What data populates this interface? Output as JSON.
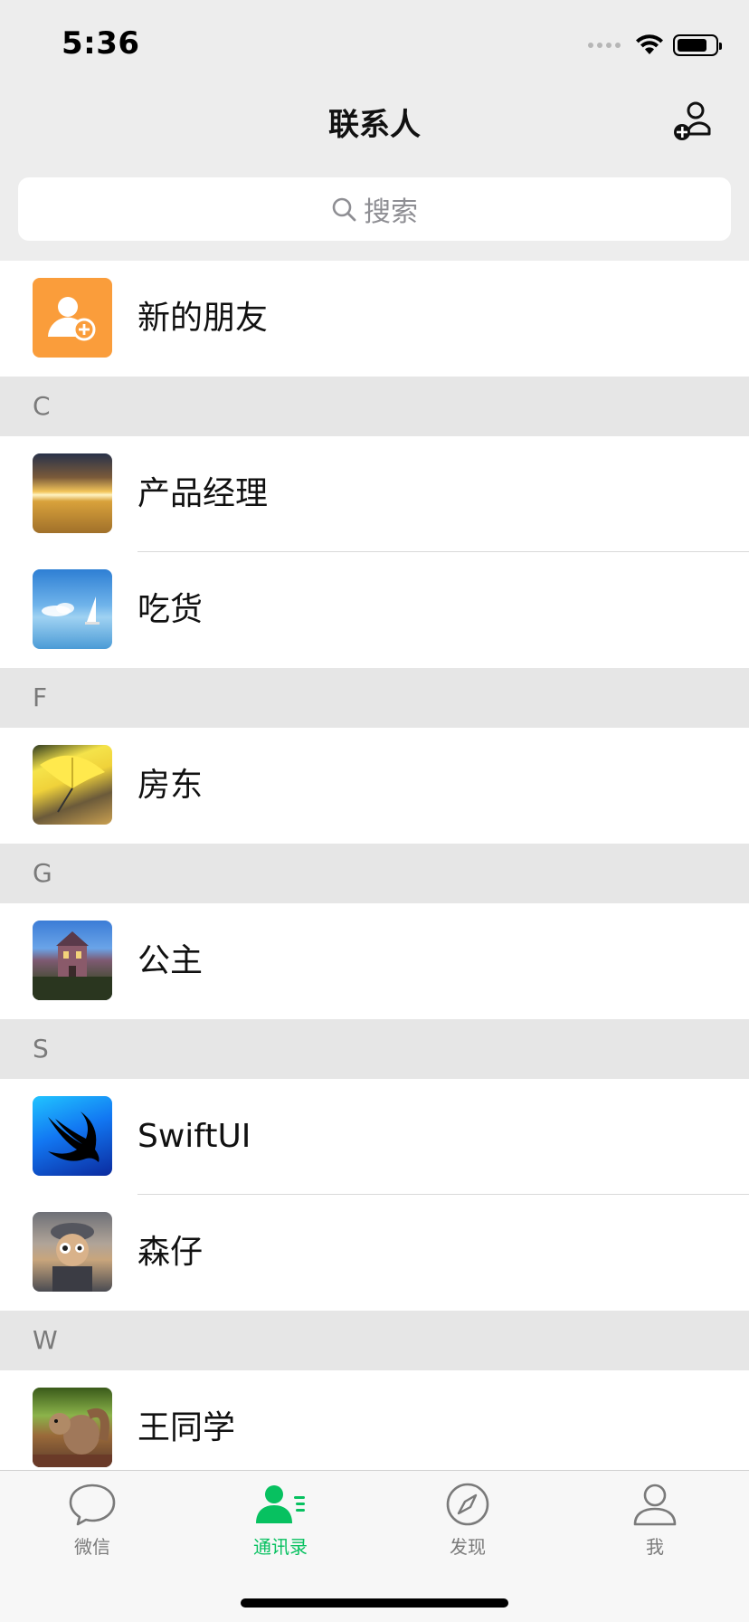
{
  "status_bar": {
    "time": "5:36"
  },
  "nav": {
    "title": "联系人",
    "add_icon": "add-contact-icon"
  },
  "search": {
    "placeholder": "搜索",
    "icon": "search-icon"
  },
  "new_friends": {
    "label": "新的朋友"
  },
  "sections": [
    {
      "letter": "C",
      "contacts": [
        "产品经理",
        "吃货"
      ]
    },
    {
      "letter": "F",
      "contacts": [
        "房东"
      ]
    },
    {
      "letter": "G",
      "contacts": [
        "公主"
      ]
    },
    {
      "letter": "S",
      "contacts": [
        "SwiftUI",
        "森仔"
      ]
    },
    {
      "letter": "W",
      "contacts": [
        "王同学"
      ]
    }
  ],
  "tabs": [
    {
      "label": "微信",
      "icon": "chat-bubble-icon",
      "active": false
    },
    {
      "label": "通讯录",
      "icon": "contacts-icon",
      "active": true
    },
    {
      "label": "发现",
      "icon": "compass-icon",
      "active": false
    },
    {
      "label": "我",
      "icon": "person-icon",
      "active": false
    }
  ],
  "colors": {
    "accent": "#07c160",
    "new_friends_bg": "#fa9d3b",
    "background": "#ededed"
  }
}
